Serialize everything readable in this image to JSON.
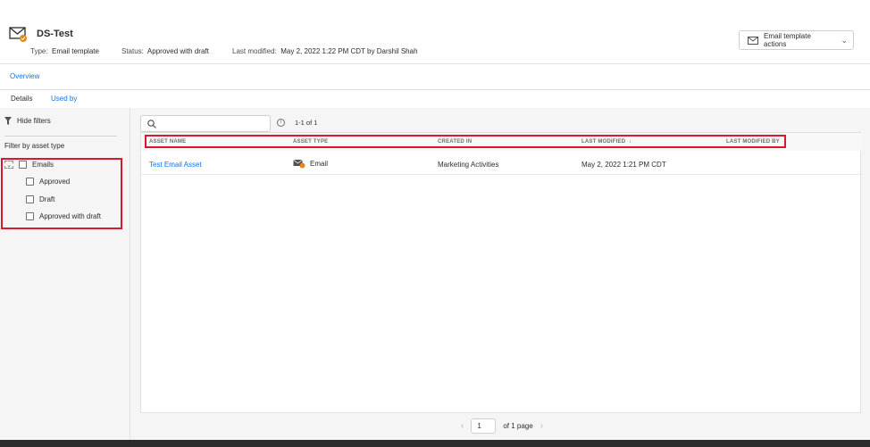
{
  "header": {
    "title": "DS-Test",
    "icon": "email-template-icon",
    "type_label": "Type:",
    "type_value": "Email template",
    "status_label": "Status:",
    "status_value": "Approved with draft",
    "modified_label": "Last modified:",
    "modified_value": "May 2, 2022 1:22 PM CDT by Darshil Shah",
    "actions_button": "Email template actions"
  },
  "tabs": {
    "primary": "Overview",
    "details": "Details",
    "used_by": "Used by"
  },
  "sidebar": {
    "hide_filters": "Hide filters",
    "filter_title": "Filter by asset type",
    "parent": "Emails",
    "children": [
      "Approved",
      "Draft",
      "Approved with draft"
    ]
  },
  "main": {
    "search_placeholder": "",
    "count": "1-1 of 1",
    "columns": [
      "ASSET NAME",
      "ASSET TYPE",
      "CREATED IN",
      "LAST MODIFIED",
      "LAST MODIFIED BY"
    ],
    "sort_indicator": "↓",
    "rows": [
      {
        "asset_name": "Test Email Asset",
        "asset_type": "Email",
        "created_in": "Marketing Activities",
        "last_modified": "May 2, 2022 1:21 PM CDT",
        "last_modified_by": ""
      }
    ]
  },
  "pagination": {
    "page": "1",
    "of_pages": "of 1 page"
  },
  "colors": {
    "accent": "#1473e6",
    "highlight": "#d7192a"
  }
}
